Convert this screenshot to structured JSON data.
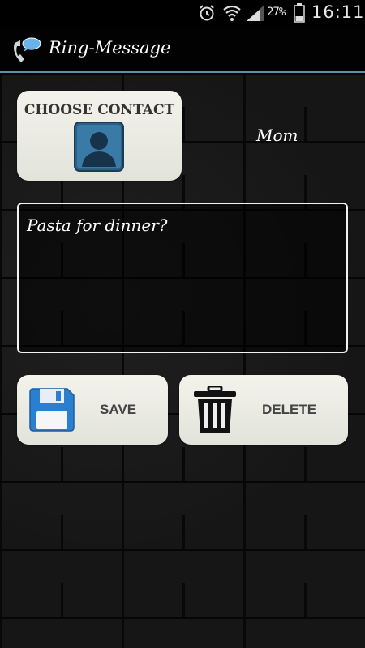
{
  "status_bar": {
    "battery_percent": "27%",
    "time": "16:11",
    "icons": [
      "alarm-icon",
      "wifi-icon",
      "signal-icon",
      "battery-icon"
    ]
  },
  "title_bar": {
    "title": "Ring-Message",
    "icon": "phone-message-icon"
  },
  "contact": {
    "button_label": "CHOOSE CONTACT",
    "icon": "contact-person-icon",
    "selected_name": "Mom"
  },
  "message": {
    "text": "Pasta for dinner?"
  },
  "actions": {
    "save_label": "SAVE",
    "save_icon": "floppy-disk-icon",
    "delete_label": "DELETE",
    "delete_icon": "trash-icon"
  },
  "colors": {
    "accent_line": "#5f8fa8",
    "button_bg": "#e9eae2",
    "save_icon_blue": "#2a7fd1"
  }
}
